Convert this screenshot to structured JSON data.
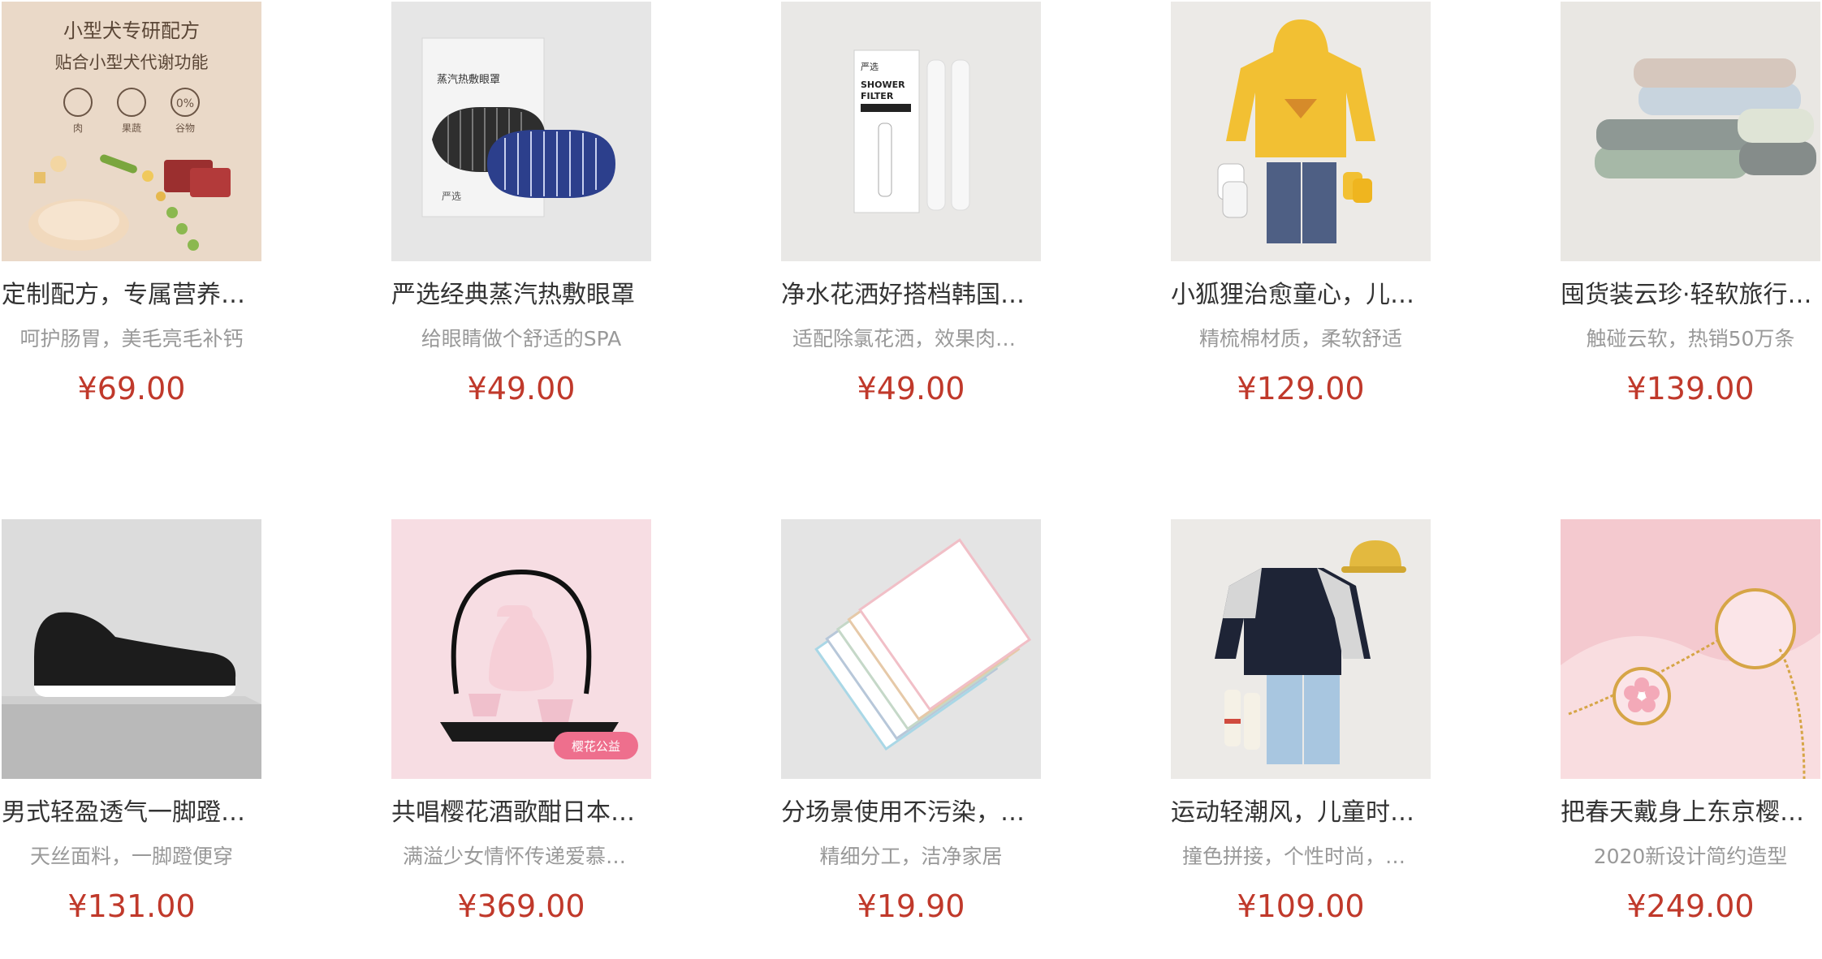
{
  "products": [
    {
      "title": "定制配方，专属营养配比",
      "desc": "呵护肠胃，美毛亮毛补钙",
      "price": "¥69.00",
      "image": "dog-food-box",
      "image_text": {
        "headline": "小型犬专研配方",
        "subhead": "贴合小型犬代谢功能",
        "badges": [
          "肉",
          "果蔬",
          "谷物"
        ],
        "badge_pct": "0%"
      }
    },
    {
      "title": "严选经典蒸汽热敷眼罩",
      "desc": "给眼睛做个舒适的SPA",
      "price": "¥49.00",
      "image": "steam-eye-mask",
      "image_text": {
        "pack": "蒸汽热敷眼罩",
        "brand": "严选"
      }
    },
    {
      "title": "净水花洒好搭档韩国进口",
      "desc": "适配除氯花洒，效果肉眼可见",
      "price": "¥49.00",
      "image": "shower-filter",
      "image_text": {
        "brand": "严选",
        "line1": "SHOWER",
        "line2": "FILTER"
      }
    },
    {
      "title": "小狐狸治愈童心，儿童卫衣",
      "desc": "精梳棉材质，柔软舒适",
      "price": "¥129.00",
      "image": "kids-hoodie"
    },
    {
      "title": "囤货装云珍·轻软旅行毛巾",
      "desc": "触碰云软，热销50万条",
      "price": "¥139.00",
      "image": "towel-stack"
    },
    {
      "title": "男式轻盈透气一脚蹬休闲鞋",
      "desc": "天丝面料，一脚蹬便穿",
      "price": "¥131.00",
      "image": "black-slip-on"
    },
    {
      "title": "共唱樱花酒歌酣日本清酒套装",
      "desc": "满溢少女情怀传递爱慕之情",
      "price": "¥369.00",
      "image": "sake-set",
      "image_text": {
        "tag": "樱花公益"
      }
    },
    {
      "title": "分场景使用不污染，方巾套装",
      "desc": "精细分工，洁净家居",
      "price": "¥19.90",
      "image": "handkerchiefs"
    },
    {
      "title": "运动轻潮风，儿童时尚卫衣",
      "desc": "撞色拼接，个性时尚，百搭",
      "price": "¥109.00",
      "image": "kids-sweatshirt"
    },
    {
      "title": "把春天戴身上东京樱花项链",
      "desc": "2020新设计简约造型",
      "price": "¥249.00",
      "image": "sakura-bracelet"
    }
  ],
  "colors": {
    "price": "#c0392b",
    "title": "#333333",
    "desc": "#999999"
  }
}
